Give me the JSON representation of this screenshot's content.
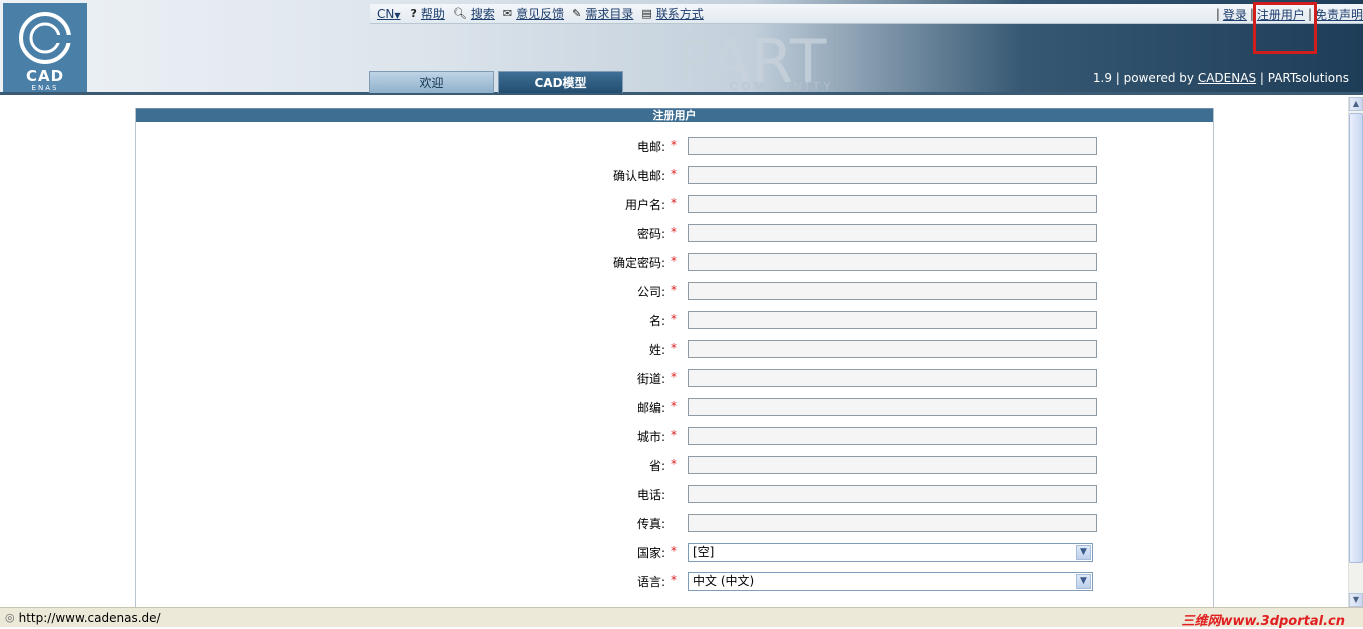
{
  "header": {
    "logo_text": "CAD",
    "logo_sub": "ENAS",
    "part_title": "PART",
    "part_sub": "COMMUNITY",
    "lang": "CN",
    "help": "帮助",
    "search": "搜索",
    "feedback": "意见反馈",
    "request_catalog": "需求目录",
    "contact": "联系方式",
    "login": "登录",
    "register": "注册用户",
    "disclaimer": "免责声明",
    "tabs": [
      "欢迎",
      "CAD模型"
    ],
    "version": "1.9",
    "powered_by": "powered by",
    "cadenas": "CADENAS",
    "partsolutions": "PARTsolutions"
  },
  "form": {
    "title": "注册用户",
    "fields": [
      {
        "label": "电邮:",
        "required": true,
        "value": ""
      },
      {
        "label": "确认电邮:",
        "required": true,
        "value": ""
      },
      {
        "label": "用户名:",
        "required": true,
        "value": ""
      },
      {
        "label": "密码:",
        "required": true,
        "value": ""
      },
      {
        "label": "确定密码:",
        "required": true,
        "value": ""
      },
      {
        "label": "公司:",
        "required": true,
        "value": ""
      },
      {
        "label": "名:",
        "required": true,
        "value": ""
      },
      {
        "label": "姓:",
        "required": true,
        "value": ""
      },
      {
        "label": "街道:",
        "required": true,
        "value": ""
      },
      {
        "label": "邮编:",
        "required": true,
        "value": ""
      },
      {
        "label": "城市:",
        "required": true,
        "value": ""
      },
      {
        "label": "省:",
        "required": true,
        "value": ""
      },
      {
        "label": "电话:",
        "required": false,
        "value": ""
      },
      {
        "label": "传真:",
        "required": false,
        "value": ""
      }
    ],
    "country_label": "国家:",
    "country_value": "[空]",
    "language_label": "语言:",
    "language_value": "中文 (中文)"
  },
  "status": {
    "url": "http://www.cadenas.de/",
    "watermark": "三维网www.3dportal.cn"
  },
  "colors": {
    "accent": "#3e6f92",
    "highlight": "#d21d1d",
    "required": "#dd2222"
  }
}
